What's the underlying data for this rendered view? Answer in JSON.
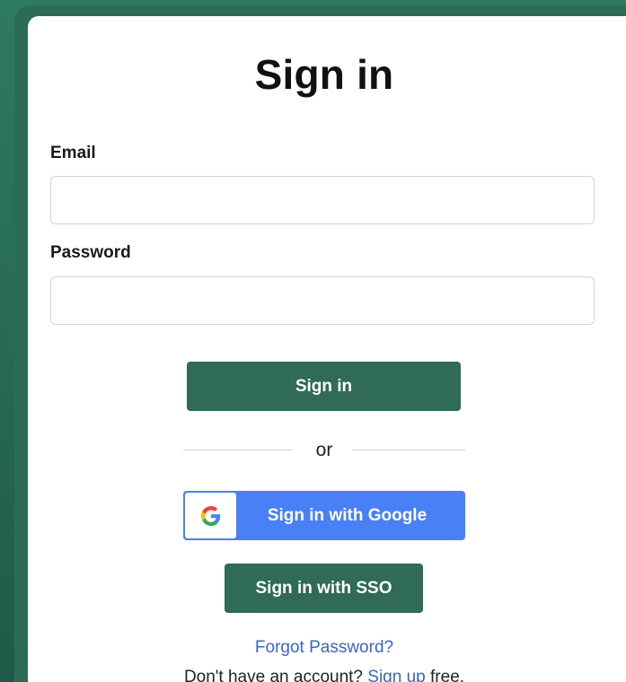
{
  "page": {
    "title": "Sign in"
  },
  "form": {
    "email_label": "Email",
    "email_value": "",
    "password_label": "Password",
    "password_value": "",
    "submit_label": "Sign in"
  },
  "divider": {
    "text": "or"
  },
  "oauth": {
    "google_label": "Sign in with Google",
    "google_icon": "google-g-icon",
    "sso_label": "Sign in with SSO"
  },
  "footer": {
    "forgot_label": "Forgot Password?",
    "signup_prefix": "Don't have an account?",
    "signup_link": "Sign up",
    "signup_suffix": "free."
  },
  "colors": {
    "brand_green": "#2f6b55",
    "google_blue": "#4a80f5",
    "link_blue": "#3a66c4"
  }
}
